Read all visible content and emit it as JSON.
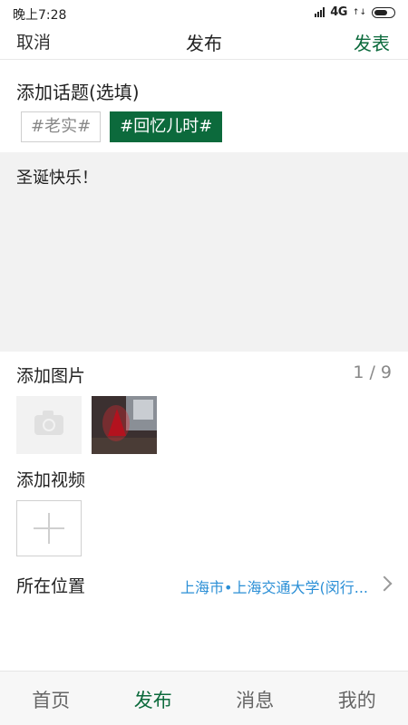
{
  "status_bar": {
    "time": "晚上7:28",
    "network": "4G",
    "network_sub": "↑↓"
  },
  "nav": {
    "cancel_label": "取消",
    "title": "发布",
    "publish_label": "发表",
    "accent_color": "#0c6a3c"
  },
  "topic": {
    "label": "添加话题(选填)",
    "chips": [
      {
        "label": "#老实#",
        "selected": false
      },
      {
        "label": "#回忆儿时#",
        "selected": true
      }
    ]
  },
  "post": {
    "content": "圣诞快乐！"
  },
  "photos": {
    "label": "添加图片",
    "count": "1 / 9",
    "add_icon": "camera-icon"
  },
  "video": {
    "label": "添加视频",
    "add_icon": "plus-icon"
  },
  "location": {
    "label": "所在位置",
    "value": "上海市•上海交通大学(闵行...",
    "value_color": "#2b8fd6"
  },
  "tabs": [
    {
      "label": "首页",
      "active": false
    },
    {
      "label": "发布",
      "active": true
    },
    {
      "label": "消息",
      "active": false
    },
    {
      "label": "我的",
      "active": false
    }
  ]
}
